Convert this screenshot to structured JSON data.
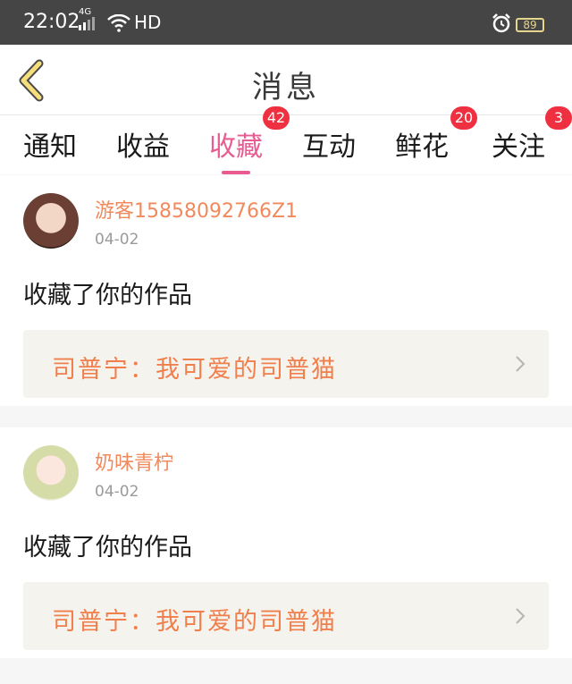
{
  "status_bar": {
    "time": "22:02",
    "network": "4G",
    "hd": "HD",
    "battery": "89"
  },
  "header": {
    "title": "消息"
  },
  "tabs": [
    {
      "label": "通知",
      "badge": ""
    },
    {
      "label": "收益",
      "badge": ""
    },
    {
      "label": "收藏",
      "badge": "42",
      "active": true
    },
    {
      "label": "互动",
      "badge": ""
    },
    {
      "label": "鲜花",
      "badge": "20"
    },
    {
      "label": "关注",
      "badge": "3"
    }
  ],
  "notifications": [
    {
      "user": "游客15858092766Z1",
      "date": "04-02",
      "action": "收藏了你的作品",
      "work_title": "司普宁：我可爱的司普猫"
    },
    {
      "user": "奶味青柠",
      "date": "04-02",
      "action": "收藏了你的作品",
      "work_title": "司普宁：我可爱的司普猫"
    }
  ],
  "colors": {
    "accent": "#e85c91",
    "badge": "#ee3040",
    "username": "#f08a5d",
    "work_title": "#f07f4c"
  }
}
